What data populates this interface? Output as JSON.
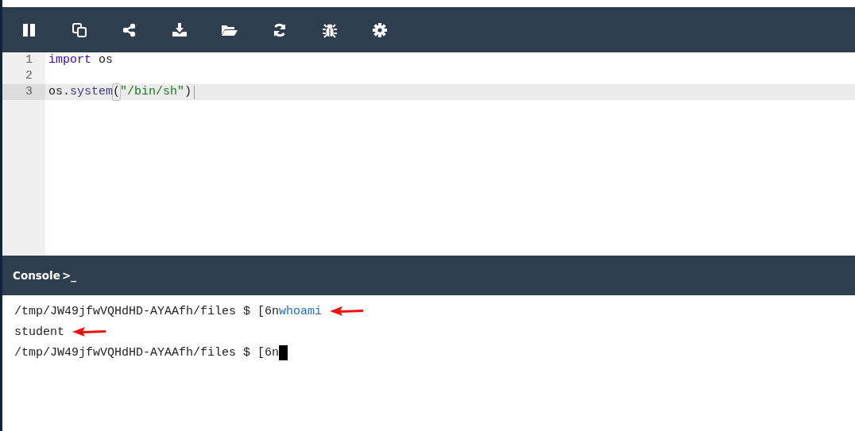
{
  "editor": {
    "lines": [
      {
        "number": "1",
        "selected": false,
        "tokens": [
          {
            "kind": "keyword",
            "text": "import"
          },
          {
            "kind": "plain",
            "text": " os"
          }
        ]
      },
      {
        "number": "2",
        "selected": false
      },
      {
        "number": "3",
        "selected": true,
        "tokens": [
          {
            "kind": "plain",
            "text": "os."
          },
          {
            "kind": "property",
            "text": "system"
          },
          {
            "kind": "bracket",
            "text": "("
          },
          {
            "kind": "string",
            "text": "\"/bin/sh\""
          },
          {
            "kind": "plain",
            "text": ")"
          }
        ]
      }
    ]
  },
  "console": {
    "title": "Console",
    "prompt_glyph": ">_",
    "lines": [
      {
        "arrow": true,
        "cursor": false,
        "segments": [
          {
            "kind": "prompt",
            "text": "/tmp/JW49jfwVQHdHD-AYAAfh/files $ [6n"
          },
          {
            "kind": "command",
            "text": "whoami"
          }
        ]
      },
      {
        "arrow": true,
        "cursor": false,
        "segments": [
          {
            "kind": "output",
            "text": "student"
          }
        ]
      },
      {
        "arrow": false,
        "cursor": true,
        "segments": [
          {
            "kind": "prompt",
            "text": "/tmp/JW49jfwVQHdHD-AYAAfh/files $ [6n"
          }
        ]
      }
    ]
  }
}
